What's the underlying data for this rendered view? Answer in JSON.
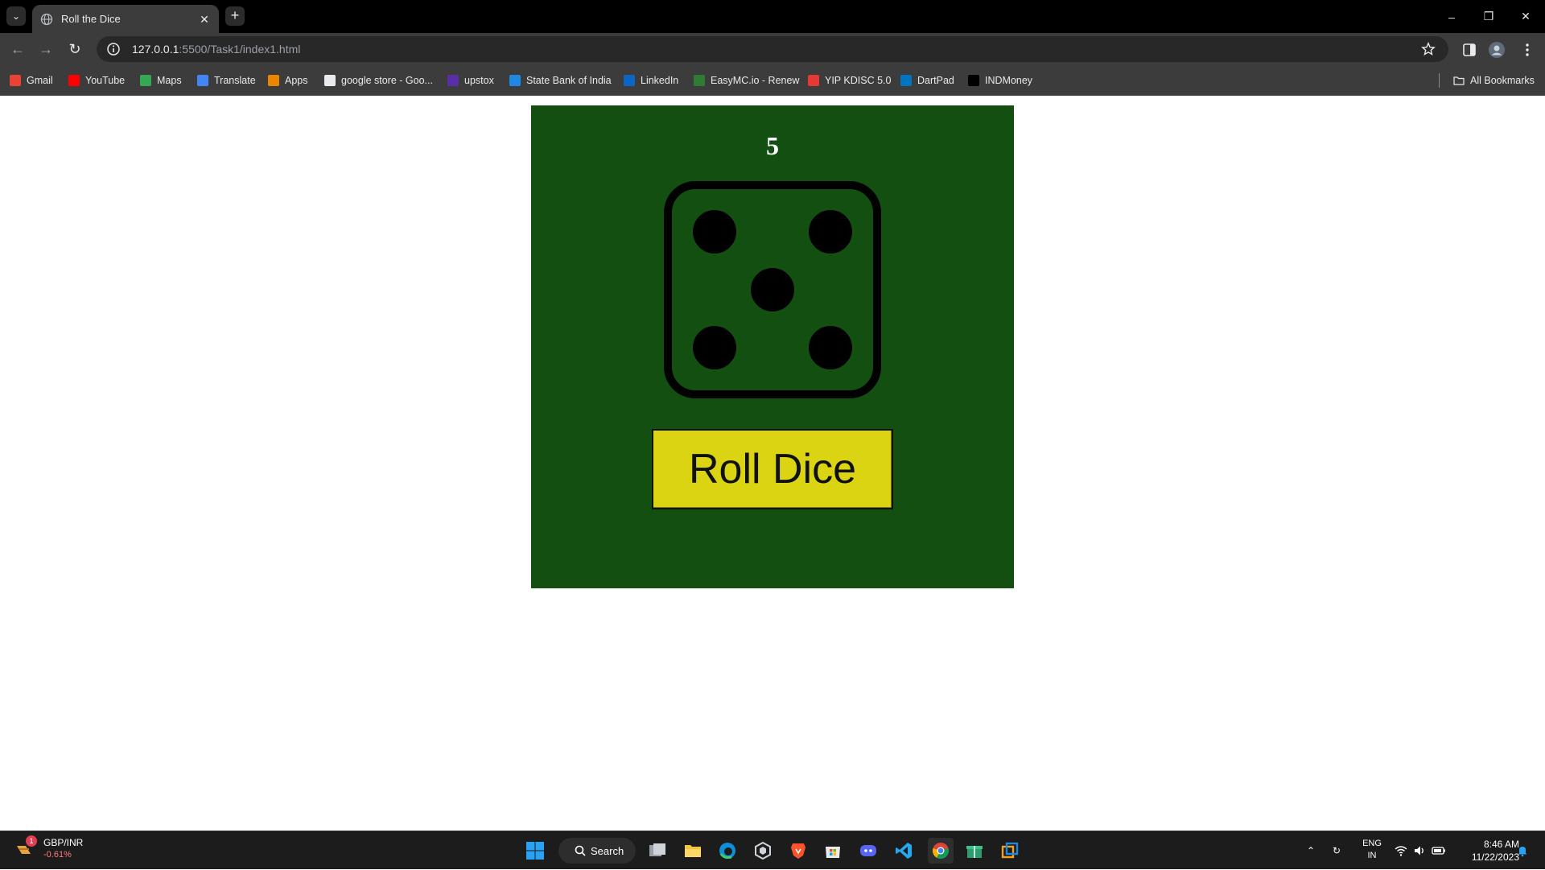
{
  "browser": {
    "tab": {
      "title": "Roll the Dice"
    },
    "url": {
      "host": "127.0.0.1",
      "path": ":5500/Task1/index1.html"
    },
    "bookmarks": [
      {
        "label": "Gmail",
        "icon": "gmail-icon",
        "color": "#ea4335"
      },
      {
        "label": "YouTube",
        "icon": "youtube-icon",
        "color": "#ff0000"
      },
      {
        "label": "Maps",
        "icon": "maps-icon",
        "color": "#34a853"
      },
      {
        "label": "Translate",
        "icon": "translate-icon",
        "color": "#4285f4"
      },
      {
        "label": "Apps",
        "icon": "apps-grid-icon",
        "color": "#ea8600"
      },
      {
        "label": "google store - Goo...",
        "icon": "google-store-icon",
        "color": "#e8eaed"
      },
      {
        "label": "upstox",
        "icon": "upstox-icon",
        "color": "#5a2ea6"
      },
      {
        "label": "State Bank of India",
        "icon": "sbi-icon",
        "color": "#1e88e5"
      },
      {
        "label": "LinkedIn",
        "icon": "linkedin-icon",
        "color": "#0a66c2"
      },
      {
        "label": "EasyMC.io - Renew",
        "icon": "easymc-icon",
        "color": "#2e7d32"
      },
      {
        "label": "YIP KDISC 5.0",
        "icon": "yip-icon",
        "color": "#e53935"
      },
      {
        "label": "DartPad",
        "icon": "dartpad-icon",
        "color": "#0175c2"
      },
      {
        "label": "INDMoney",
        "icon": "indmoney-icon",
        "color": "#000000"
      }
    ],
    "all_bookmarks_label": "All Bookmarks"
  },
  "game": {
    "result": "5",
    "die_face": 5,
    "button_label": "Roll Dice",
    "colors": {
      "panel": "#124f11",
      "button": "#dbd413",
      "pip": "#000000"
    }
  },
  "taskbar": {
    "widget": {
      "pair": "GBP/INR",
      "change": "-0.61%",
      "badge": "1"
    },
    "search_label": "Search",
    "language": {
      "line1": "ENG",
      "line2": "IN"
    },
    "clock": {
      "time": "8:46 AM",
      "date": "11/22/2023"
    }
  }
}
